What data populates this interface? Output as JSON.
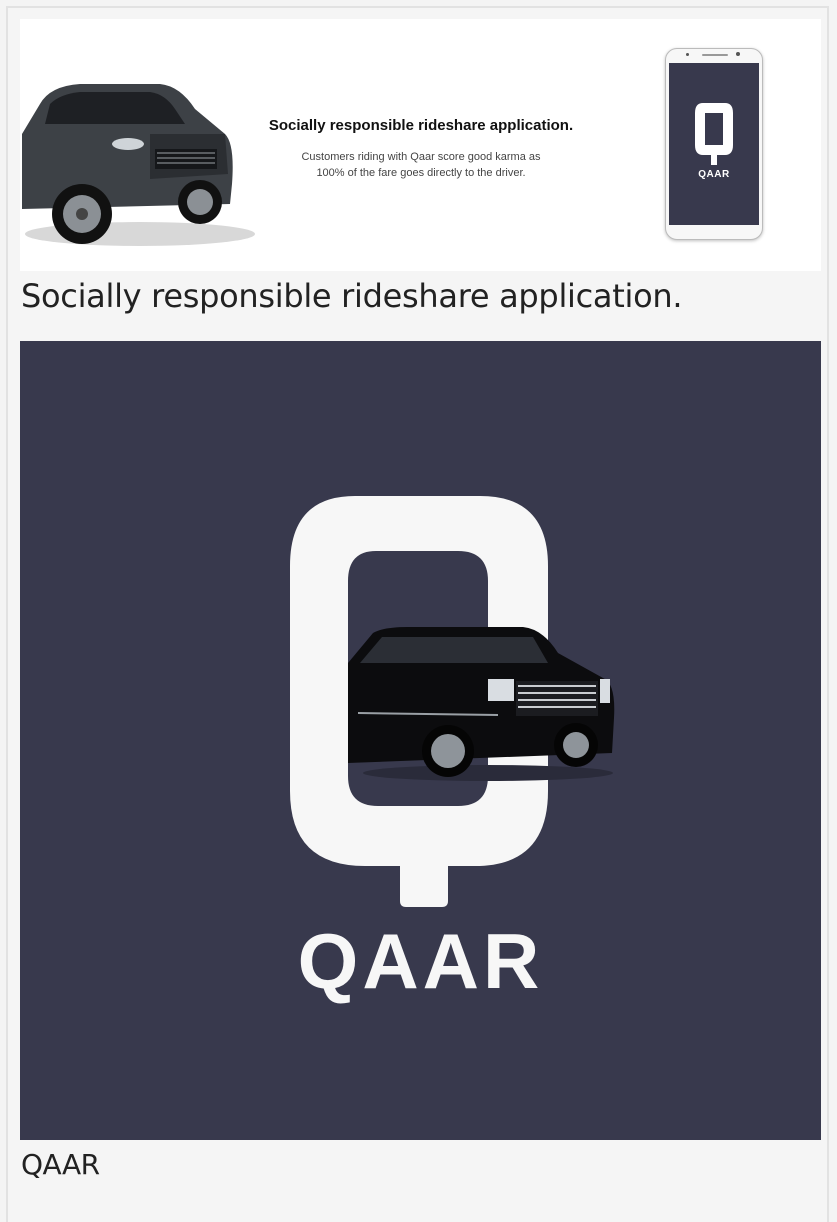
{
  "banner": {
    "title": "Socially responsible rideshare application.",
    "body_line1": "Customers riding with Qaar score good karma as",
    "body_line2": "100% of the fare goes directly to the driver.",
    "phone_label": "QAAR",
    "screen_color": "#38394d"
  },
  "captions": {
    "first": "Socially responsible rideshare application.",
    "second": "QAAR"
  },
  "hero": {
    "label": "QAAR",
    "background": "#38394d",
    "logo_color": "#f7f7f7"
  }
}
